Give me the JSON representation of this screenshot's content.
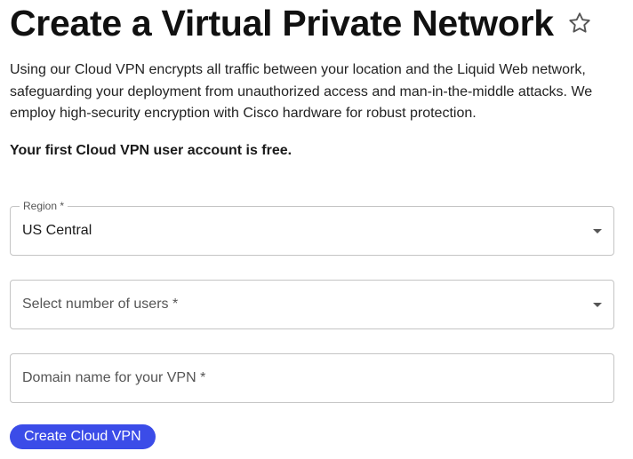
{
  "header": {
    "title": "Create a Virtual Private Network",
    "favorite_icon": "star-outline-icon"
  },
  "intro": {
    "description": "Using our Cloud VPN encrypts all traffic between your location and the Liquid Web network, safeguarding your deployment from unauthorized access and man-in-the-middle attacks. We employ high-security encryption with Cisco hardware for robust protection.",
    "free_note": "Your first Cloud VPN user account is free."
  },
  "form": {
    "region": {
      "label": "Region *",
      "value": "US Central",
      "icon": "caret-down-icon"
    },
    "users": {
      "placeholder": "Select number of users *",
      "icon": "caret-down-icon"
    },
    "domain": {
      "placeholder": "Domain name for your VPN *"
    },
    "submit_label": "Create Cloud VPN"
  },
  "colors": {
    "primary_button": "#3b4ce8",
    "border": "#c4c4c4",
    "text": "#1a1a1a"
  }
}
